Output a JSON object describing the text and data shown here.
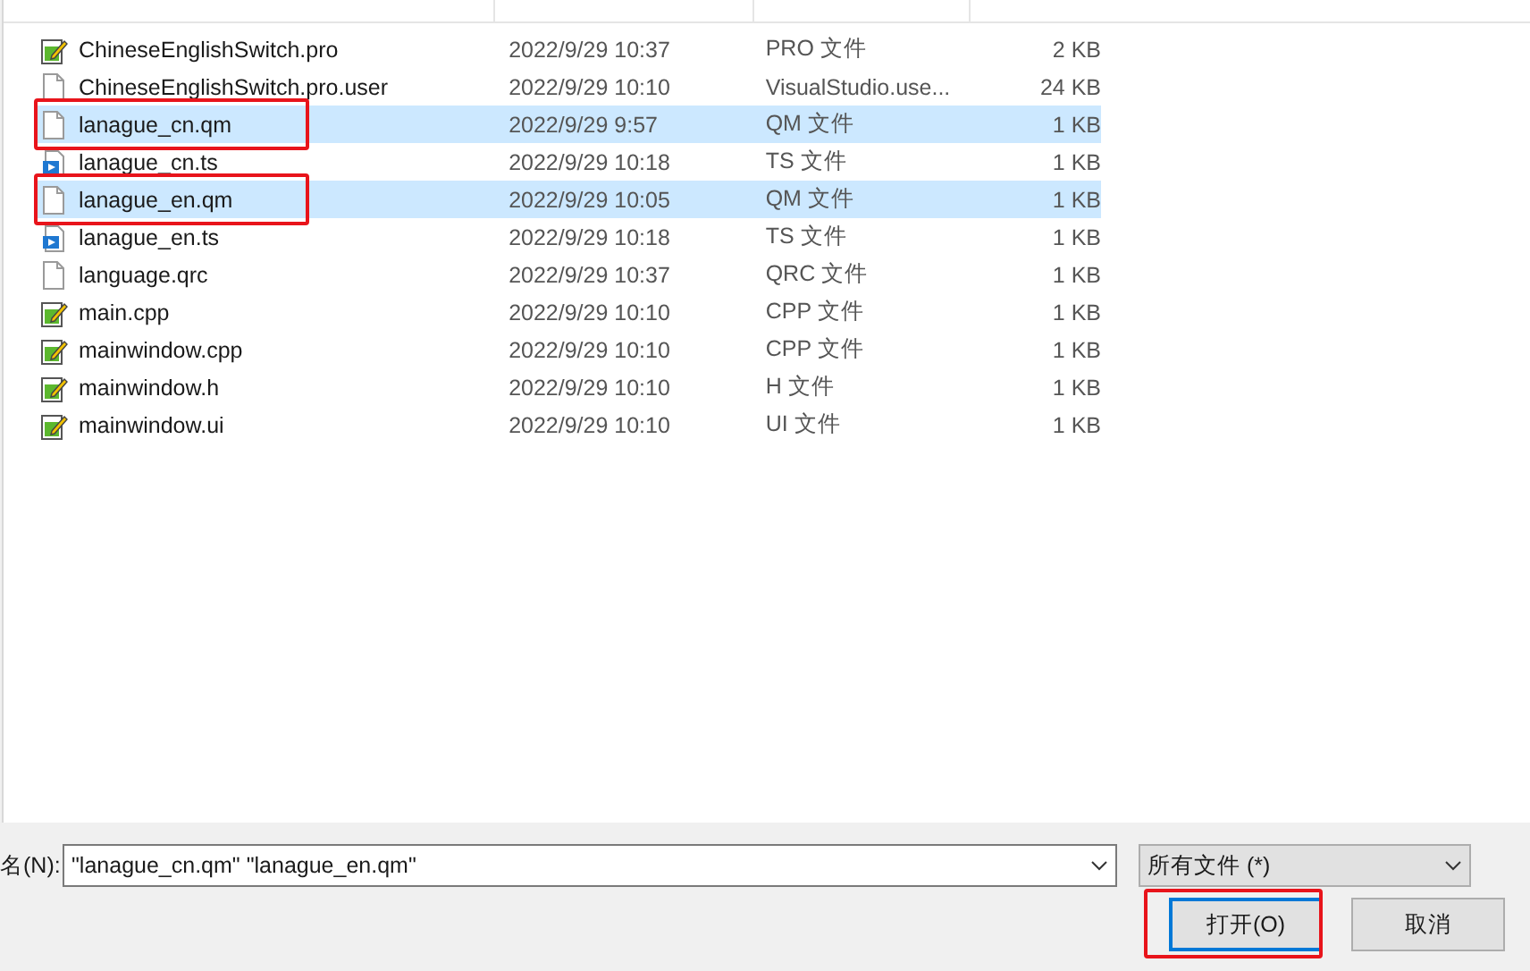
{
  "files": [
    {
      "name": "ChineseEnglishSwitch.pro",
      "modified": "2022/9/29 10:37",
      "type": "PRO 文件",
      "size": "2 KB",
      "kind": "script",
      "selected": false,
      "annotated": false
    },
    {
      "name": "ChineseEnglishSwitch.pro.user",
      "modified": "2022/9/29 10:10",
      "type": "VisualStudio.use...",
      "size": "24 KB",
      "kind": "blank",
      "selected": false,
      "annotated": false
    },
    {
      "name": "lanague_cn.qm",
      "modified": "2022/9/29 9:57",
      "type": "QM 文件",
      "size": "1 KB",
      "kind": "blank",
      "selected": true,
      "annotated": true
    },
    {
      "name": "lanague_cn.ts",
      "modified": "2022/9/29 10:18",
      "type": "TS 文件",
      "size": "1 KB",
      "kind": "media",
      "selected": false,
      "annotated": false
    },
    {
      "name": "lanague_en.qm",
      "modified": "2022/9/29 10:05",
      "type": "QM 文件",
      "size": "1 KB",
      "kind": "blank",
      "selected": true,
      "annotated": true
    },
    {
      "name": "lanague_en.ts",
      "modified": "2022/9/29 10:18",
      "type": "TS 文件",
      "size": "1 KB",
      "kind": "media",
      "selected": false,
      "annotated": false
    },
    {
      "name": "language.qrc",
      "modified": "2022/9/29 10:37",
      "type": "QRC 文件",
      "size": "1 KB",
      "kind": "blank",
      "selected": false,
      "annotated": false
    },
    {
      "name": "main.cpp",
      "modified": "2022/9/29 10:10",
      "type": "CPP 文件",
      "size": "1 KB",
      "kind": "script",
      "selected": false,
      "annotated": false
    },
    {
      "name": "mainwindow.cpp",
      "modified": "2022/9/29 10:10",
      "type": "CPP 文件",
      "size": "1 KB",
      "kind": "script",
      "selected": false,
      "annotated": false
    },
    {
      "name": "mainwindow.h",
      "modified": "2022/9/29 10:10",
      "type": "H 文件",
      "size": "1 KB",
      "kind": "script",
      "selected": false,
      "annotated": false
    },
    {
      "name": "mainwindow.ui",
      "modified": "2022/9/29 10:10",
      "type": "UI 文件",
      "size": "1 KB",
      "kind": "script",
      "selected": false,
      "annotated": false
    }
  ],
  "filename": {
    "label": "名(N):",
    "value": "\"lanague_cn.qm\" \"lanague_en.qm\""
  },
  "filetype": {
    "value": "所有文件 (*)"
  },
  "buttons": [
    {
      "label": "打开(O)",
      "default": true,
      "annotated": true
    },
    {
      "label": "取消",
      "default": false,
      "annotated": false
    }
  ]
}
